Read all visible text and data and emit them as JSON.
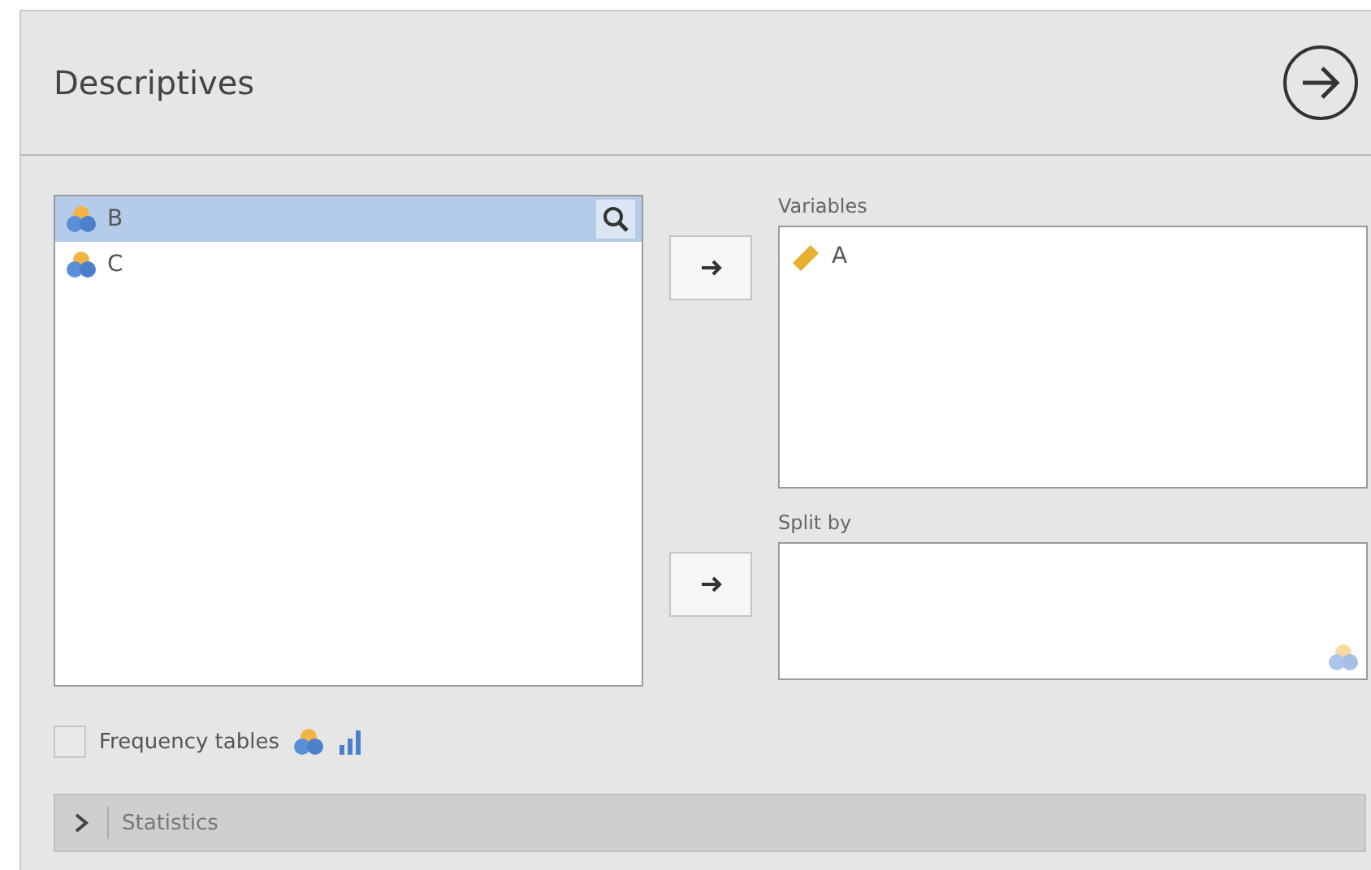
{
  "title": "Descriptives",
  "source_list": {
    "items": [
      {
        "label": "B",
        "kind": "nominal",
        "selected": true
      },
      {
        "label": "C",
        "kind": "nominal",
        "selected": false
      }
    ]
  },
  "targets": [
    {
      "label": "Variables",
      "items": [
        {
          "label": "A",
          "kind": "continuous"
        }
      ],
      "hint_icon": false
    },
    {
      "label": "Split by",
      "hint_icon": true
    }
  ],
  "frequency_tables": {
    "label": "Frequency tables",
    "checked": false
  },
  "sections": [
    {
      "label": "Statistics",
      "expanded": false
    }
  ]
}
